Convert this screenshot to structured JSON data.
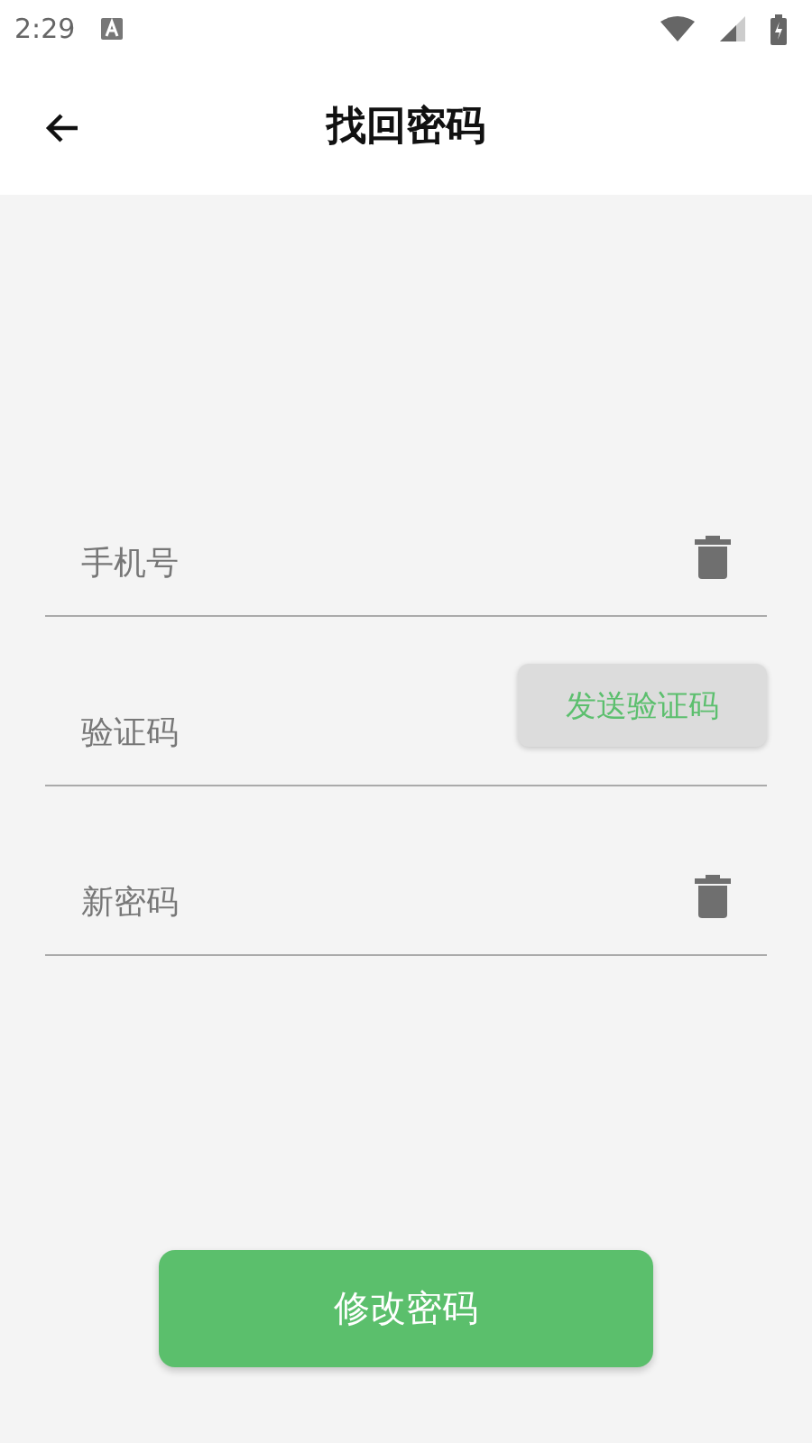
{
  "status_bar": {
    "time": "2:29"
  },
  "header": {
    "title": "找回密码"
  },
  "fields": [
    {
      "kind": "clearable",
      "placeholder": "手机号"
    },
    {
      "kind": "code",
      "placeholder": "验证码",
      "button": "发送验证码"
    },
    {
      "kind": "clearable",
      "placeholder": "新密码"
    }
  ],
  "submit": {
    "label": "修改密码"
  }
}
